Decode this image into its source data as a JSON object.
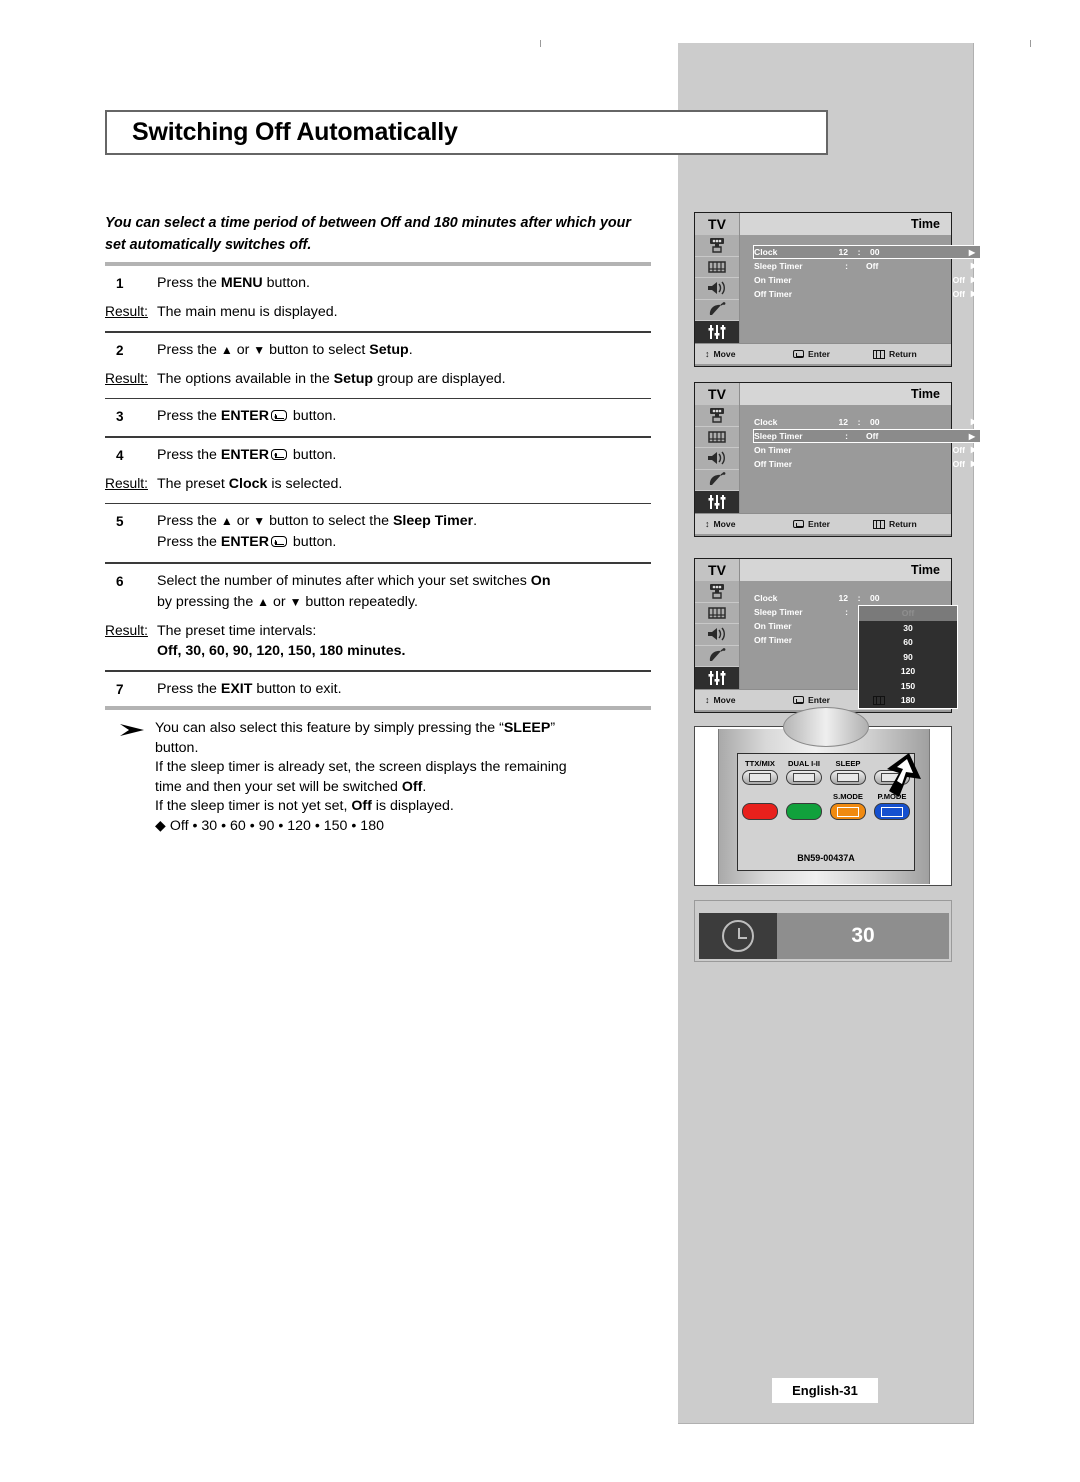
{
  "page": {
    "title": "Switching Off Automatically",
    "footer_label": "English-31",
    "intro": "You can select a time period of between Off and 180 minutes after which your set automatically switches off."
  },
  "steps": [
    {
      "number": "1",
      "text_parts": [
        {
          "t": "Press the ",
          "b": false
        },
        {
          "t": "MENU",
          "b": true
        },
        {
          "t": " button.",
          "b": false
        }
      ],
      "result_label": "Result:",
      "result_parts": [
        {
          "t": "The main menu is displayed.",
          "b": false
        }
      ]
    },
    {
      "number": "2",
      "text_parts": [
        {
          "t": "Press the ",
          "b": false
        },
        {
          "t": "▲",
          "b": false
        },
        {
          "t": " or ",
          "b": false
        },
        {
          "t": "▼",
          "b": false
        },
        {
          "t": " button to select ",
          "b": false
        },
        {
          "t": "Setup",
          "b": true
        },
        {
          "t": ".",
          "b": false
        }
      ],
      "result_label": "Result:",
      "result_parts": [
        {
          "t": "The options available in the ",
          "b": false
        },
        {
          "t": "Setup",
          "b": true
        },
        {
          "t": " group are displayed.",
          "b": false
        }
      ]
    },
    {
      "number": "3",
      "text_parts": [
        {
          "t": "Press the ",
          "b": false
        },
        {
          "t": "ENTER",
          "b": true
        },
        {
          "t": "ENTER_ICON",
          "b": false
        },
        {
          "t": " button.",
          "b": false
        }
      ],
      "result_label": "",
      "result_parts": []
    },
    {
      "number": "4",
      "text_parts": [
        {
          "t": "Press the ",
          "b": false
        },
        {
          "t": "ENTER",
          "b": true
        },
        {
          "t": "ENTER_ICON",
          "b": false
        },
        {
          "t": " button.",
          "b": false
        }
      ],
      "result_label": "Result:",
      "result_parts": [
        {
          "t": "The preset ",
          "b": false
        },
        {
          "t": "Clock",
          "b": true
        },
        {
          "t": " is selected.",
          "b": false
        }
      ]
    },
    {
      "number": "5",
      "text_parts": [
        {
          "t": "Press the ",
          "b": false
        },
        {
          "t": "▲",
          "b": false
        },
        {
          "t": " or ",
          "b": false
        },
        {
          "t": "▼",
          "b": false
        },
        {
          "t": " button to select the ",
          "b": false
        },
        {
          "t": "Sleep Timer",
          "b": true
        },
        {
          "t": ".",
          "b": false
        },
        {
          "t": "BR",
          "b": false
        },
        {
          "t": "Press the ",
          "b": false
        },
        {
          "t": "ENTER",
          "b": true
        },
        {
          "t": "ENTER_ICON",
          "b": false
        },
        {
          "t": " button.",
          "b": false
        }
      ],
      "result_label": "",
      "result_parts": []
    },
    {
      "number": "6",
      "text_parts": [
        {
          "t": "Select the number of minutes after which your set switches ",
          "b": false
        },
        {
          "t": "On",
          "b": true
        },
        {
          "t": "BR",
          "b": false
        },
        {
          "t": "by pressing the ",
          "b": false
        },
        {
          "t": "▲",
          "b": false
        },
        {
          "t": " or ",
          "b": false
        },
        {
          "t": "▼",
          "b": false
        },
        {
          "t": " button repeatedly.",
          "b": false
        }
      ],
      "result_label": "Result:",
      "result_parts": [
        {
          "t": "The preset time intervals:",
          "b": false
        },
        {
          "t": "BR",
          "b": false
        },
        {
          "t": "Off, 30, 60, 90, 120, 150, 180 minutes.",
          "b": true
        }
      ]
    },
    {
      "number": "7",
      "text_parts": [
        {
          "t": "Press the ",
          "b": false
        },
        {
          "t": "EXIT",
          "b": true
        },
        {
          "t": " button to exit.",
          "b": false
        }
      ],
      "result_label": "",
      "result_parts": []
    }
  ],
  "note": {
    "marker": "arrow-note-icon",
    "lines": [
      [
        {
          "t": "You can also select this feature by simply pressing the “",
          "b": false
        },
        {
          "t": "SLEEP",
          "b": true
        },
        {
          "t": "”",
          "b": false
        }
      ],
      [
        {
          "t": "button.",
          "b": false
        }
      ],
      [
        {
          "t": "If the sleep timer is already set, the screen displays the remaining",
          "b": false
        }
      ],
      [
        {
          "t": "time and then your set will be switched ",
          "b": false
        },
        {
          "t": "Off",
          "b": true
        },
        {
          "t": ".",
          "b": false
        }
      ],
      [
        {
          "t": "If the sleep timer is not yet set, ",
          "b": false
        },
        {
          "t": "Off",
          "b": true
        },
        {
          "t": " is displayed.",
          "b": false
        }
      ],
      [
        {
          "t": "◆ Off • 30 • 60 • 90 • 120 • 150 • 180",
          "b": false
        }
      ]
    ]
  },
  "osd": {
    "source_label": "TV",
    "menu_title": "Time",
    "sidebar_icons": [
      "input-source-icon",
      "picture-icon",
      "sound-icon",
      "channel-dish-icon",
      "setup-sliders-icon"
    ],
    "footer": {
      "move": "Move",
      "enter": "Enter",
      "return": "Return"
    },
    "items": {
      "clock": {
        "label": "Clock",
        "colon": ":",
        "hour": "12",
        "minute": "00"
      },
      "sleep_timer": {
        "label": "Sleep Timer",
        "colon": ":",
        "value": "Off"
      },
      "on_timer": {
        "label": "On Timer",
        "value": "Off"
      },
      "off_timer": {
        "label": "Off Timer",
        "value": "Off"
      }
    },
    "panels": [
      {
        "highlight": "clock"
      },
      {
        "highlight": "sleep_timer"
      },
      {
        "highlight": "dropdown"
      }
    ],
    "dropdown_options": [
      "Off",
      "30",
      "60",
      "90",
      "120",
      "150",
      "180"
    ]
  },
  "remote": {
    "top_labels": [
      "TTX/MIX",
      "DUAL I-II",
      "SLEEP",
      ""
    ],
    "bottom_labels": [
      "",
      "",
      "S.MODE",
      "P.MODE"
    ],
    "color_buttons": [
      "#e8201c",
      "#11a13c",
      "#f08a10",
      "#1550cf"
    ],
    "model": "BN59-00437A",
    "pointer": "hand-cursor-icon"
  },
  "sleep_display": {
    "icon": "clock-icon",
    "value": "30"
  }
}
